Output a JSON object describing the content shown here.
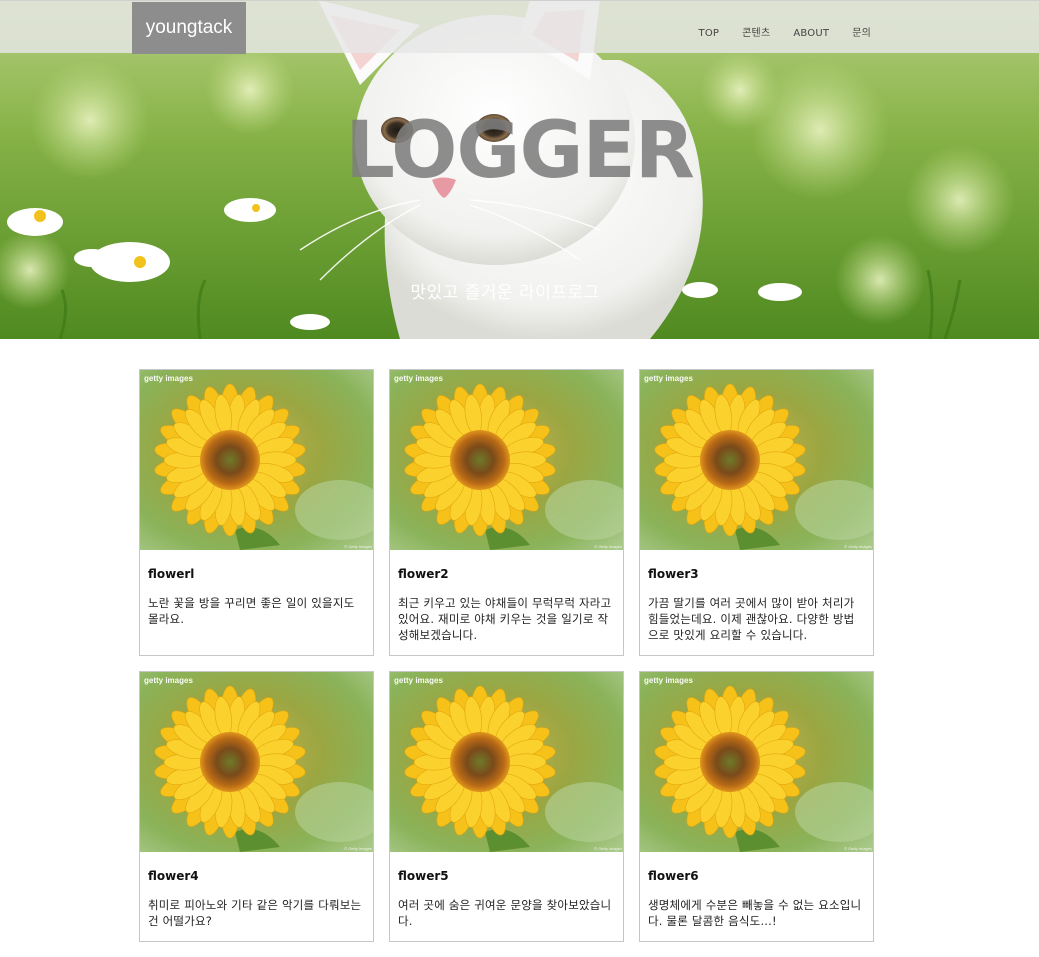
{
  "navbar": {
    "brand": "youngtack",
    "menu": [
      {
        "label": "TOP"
      },
      {
        "label": "콘텐츠"
      },
      {
        "label": "ABOUT"
      },
      {
        "label": "문의"
      }
    ]
  },
  "hero": {
    "title": "LOGGER",
    "subtitle": "맛있고 즐거운 라이프로그",
    "image": "white-kitten-in-flower-meadow"
  },
  "cards": [
    {
      "title": "flowerl",
      "description": "노란 꽃을 방을 꾸리면 좋은 일이 있을지도 몰라요.",
      "image": "sunflower",
      "watermark": "getty images"
    },
    {
      "title": "flower2",
      "description": "최근 키우고 있는 야채들이 무럭무럭 자라고 있어요. 재미로 야채 키우는 것을 일기로 작성해보겠습니다.",
      "image": "sunflower",
      "watermark": "getty images"
    },
    {
      "title": "flower3",
      "description": "가끔 딸기를 여러 곳에서 많이 받아 처리가 힘들었는데요. 이제 괜찮아요. 다양한 방법으로 맛있게 요리할 수 있습니다.",
      "image": "sunflower",
      "watermark": "getty images"
    },
    {
      "title": "flower4",
      "description": "취미로 피아노와 기타 같은 악기를 다뤄보는건 어떨가요?",
      "image": "sunflower",
      "watermark": "getty images"
    },
    {
      "title": "flower5",
      "description": "여러 곳에 숨은 귀여운 문양을 찾아보았습니다.",
      "image": "sunflower",
      "watermark": "getty images"
    },
    {
      "title": "flower6",
      "description": "생명체에게 수분은 빼놓을 수 없는 요소입니다. 물론 달콤한 음식도...!",
      "image": "sunflower",
      "watermark": "getty images"
    }
  ],
  "colors": {
    "brand_bg": "#8d8d8d",
    "navbar_bg": "#e6e6e6",
    "hero_title": "#7d7d7d",
    "card_border": "#c6c6c6"
  }
}
